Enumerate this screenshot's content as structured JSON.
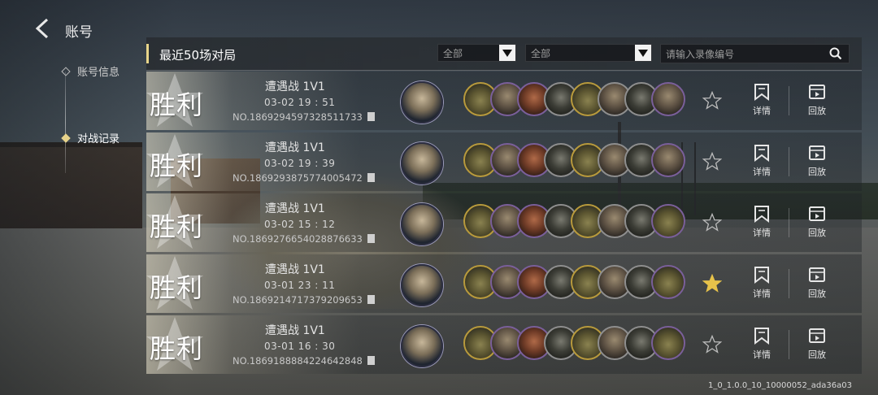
{
  "header": {
    "title": "账号"
  },
  "sidebar": {
    "items": [
      {
        "label": "账号信息",
        "active": false
      },
      {
        "label": "对战记录",
        "active": true
      }
    ]
  },
  "panel": {
    "title": "最近50场对局",
    "filter1": "全部",
    "filter2": "全部",
    "search_placeholder": "请输入录像编号"
  },
  "matches": [
    {
      "result": "胜利",
      "mode": "遭遇战 1V1",
      "time": "03-02  19 : 51",
      "number": "NO.1869294597328511733",
      "favorited": false,
      "units": [
        "tank",
        "soldier",
        "red",
        "dark",
        "tank",
        "soldier",
        "dark",
        "soldier"
      ]
    },
    {
      "result": "胜利",
      "mode": "遭遇战 1V1",
      "time": "03-02  19 : 39",
      "number": "NO.1869293875774005472",
      "favorited": false,
      "units": [
        "tank",
        "soldier",
        "red",
        "dark",
        "tank",
        "soldier",
        "dark",
        "soldier"
      ]
    },
    {
      "result": "胜利",
      "mode": "遭遇战 1V1",
      "time": "03-02  15 : 12",
      "number": "NO.1869276654028876633",
      "favorited": false,
      "units": [
        "tank",
        "soldier",
        "red",
        "dark",
        "tank",
        "soldier",
        "dark",
        "tank"
      ]
    },
    {
      "result": "胜利",
      "mode": "遭遇战 1V1",
      "time": "03-01  23 : 11",
      "number": "NO.1869214717379209653",
      "favorited": true,
      "units": [
        "tank",
        "soldier",
        "red",
        "dark",
        "tank",
        "soldier",
        "dark",
        "tank"
      ]
    },
    {
      "result": "胜利",
      "mode": "遭遇战 1V1",
      "time": "03-01  16 : 30",
      "number": "NO.1869188884224642848",
      "favorited": false,
      "units": [
        "tank",
        "soldier",
        "red",
        "dark",
        "tank",
        "soldier",
        "dark",
        "tank"
      ]
    }
  ],
  "actions": {
    "detail_label": "详情",
    "replay_label": "回放"
  },
  "version": "1_0_1.0.0_10_10000052_ada36a03",
  "colors": {
    "accent": "#e8d58a",
    "favorite_star": "#e6c24a"
  }
}
